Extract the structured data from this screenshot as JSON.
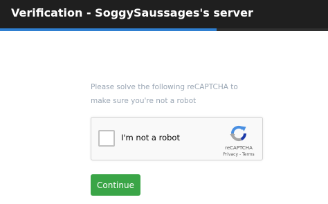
{
  "header": {
    "title": "Verification - SoggySaussages's server"
  },
  "progress": {
    "fraction": 0.66,
    "fill_color": "#2f7fd0"
  },
  "instructions": {
    "text": "Please solve the following reCAPTCHA to make sure you're not a robot"
  },
  "captcha": {
    "label": "I'm not a robot",
    "checked": false,
    "brand": "reCAPTCHA",
    "privacy_link": "Privacy",
    "separator": " - ",
    "terms_link": "Terms",
    "logo_icon": "recaptcha-logo-icon"
  },
  "actions": {
    "continue_label": "Continue",
    "continue_color": "#3aa547"
  }
}
